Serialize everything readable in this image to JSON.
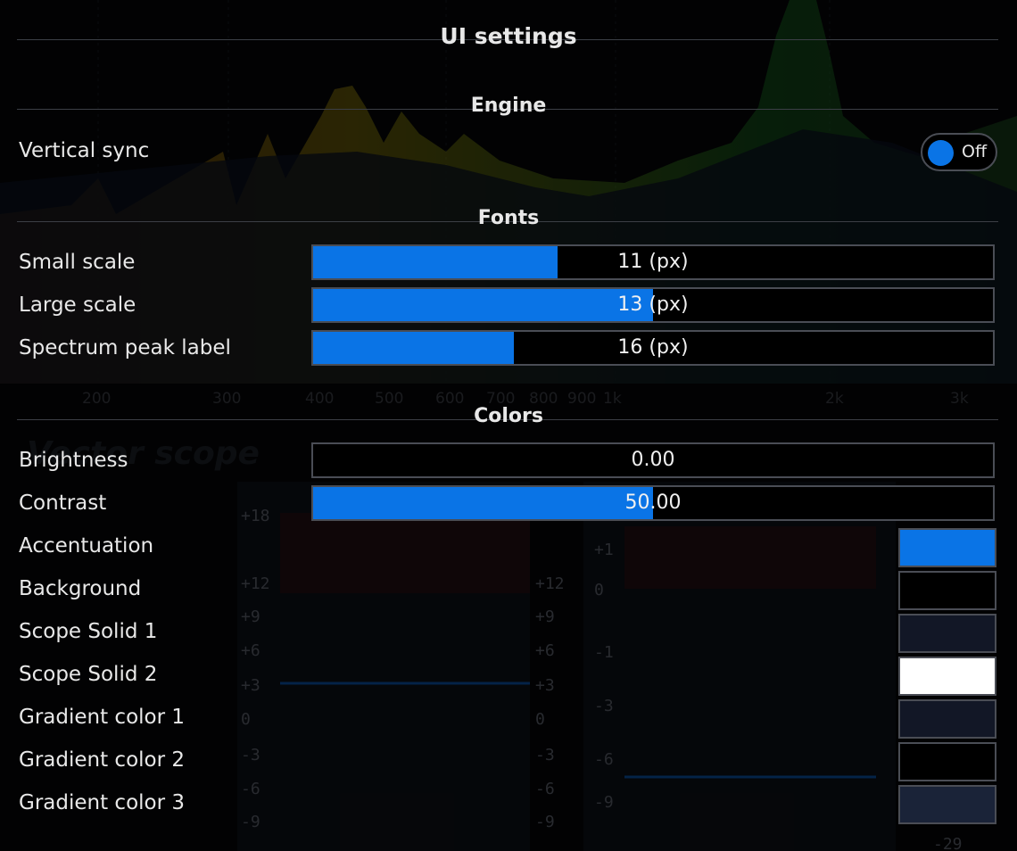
{
  "title": "UI settings",
  "sections": {
    "engine": "Engine",
    "fonts": "Fonts",
    "colors": "Colors"
  },
  "engine": {
    "vsync_label": "Vertical sync",
    "vsync_state": "Off"
  },
  "fonts": {
    "small": {
      "label": "Small scale",
      "value": "11 (px)",
      "fraction": 0.36
    },
    "large": {
      "label": "Large scale",
      "value": "13 (px)",
      "fraction": 0.5
    },
    "peak": {
      "label": "Spectrum peak label",
      "value": "16 (px)",
      "fraction": 0.295
    }
  },
  "colors": {
    "brightness": {
      "label": "Brightness",
      "value": "0.00",
      "fraction": 0.0
    },
    "contrast": {
      "label": "Contrast",
      "value": "50.00",
      "fraction": 0.5
    },
    "swatches": [
      {
        "label": "Accentuation",
        "color": "#0a74e6"
      },
      {
        "label": "Background",
        "color": "#000000"
      },
      {
        "label": "Scope Solid 1",
        "color": "#121726"
      },
      {
        "label": "Scope Solid 2",
        "color": "#ffffff"
      },
      {
        "label": "Gradient color 1",
        "color": "#121726"
      },
      {
        "label": "Gradient color 2",
        "color": "#000000"
      },
      {
        "label": "Gradient color 3",
        "color": "#1a2338"
      }
    ]
  },
  "background": {
    "freq_labels": [
      "200",
      "300",
      "400",
      "500",
      "600",
      "700",
      "800",
      "900",
      "1k",
      "2k",
      "3k"
    ],
    "panel_title": "Vector scope",
    "scale_left": [
      "+18",
      "+12",
      "+9",
      "+6",
      "+3",
      "0",
      "-3",
      "-6",
      "-9"
    ],
    "scale_mid": [
      "+12",
      "+9",
      "+6",
      "+3",
      "0",
      "-3",
      "-6",
      "-9"
    ],
    "scale_right": [
      "+1",
      "0",
      "-1",
      "-3",
      "-6",
      "-9"
    ],
    "scale_bottom": "-29"
  }
}
